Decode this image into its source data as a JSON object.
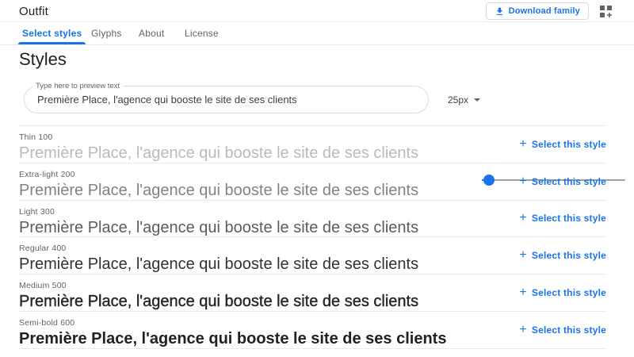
{
  "header": {
    "title": "Outfit",
    "download_button": "Download family"
  },
  "tabs": [
    {
      "label": "Select styles",
      "active": true
    },
    {
      "label": "Glyphs",
      "active": false
    },
    {
      "label": "About",
      "active": false
    },
    {
      "label": "License",
      "active": false
    }
  ],
  "section_title": "Styles",
  "preview": {
    "label": "Type here to preview text",
    "value": "Première Place, l'agence qui booste le site de ses clients",
    "font_size": "25px",
    "slider_percent": 5
  },
  "labels": {
    "select_style": "Select this style"
  },
  "styles": [
    {
      "name": "Thin 100",
      "weight": 100
    },
    {
      "name": "Extra-light 200",
      "weight": 200
    },
    {
      "name": "Light 300",
      "weight": 300
    },
    {
      "name": "Regular 400",
      "weight": 400
    },
    {
      "name": "Medium 500",
      "weight": 500
    },
    {
      "name": "Semi-bold 600",
      "weight": 600
    }
  ],
  "colors": {
    "accent": "#1a73e8",
    "text": "#202124",
    "muted": "#5f6368",
    "divider": "#e8eaed"
  }
}
